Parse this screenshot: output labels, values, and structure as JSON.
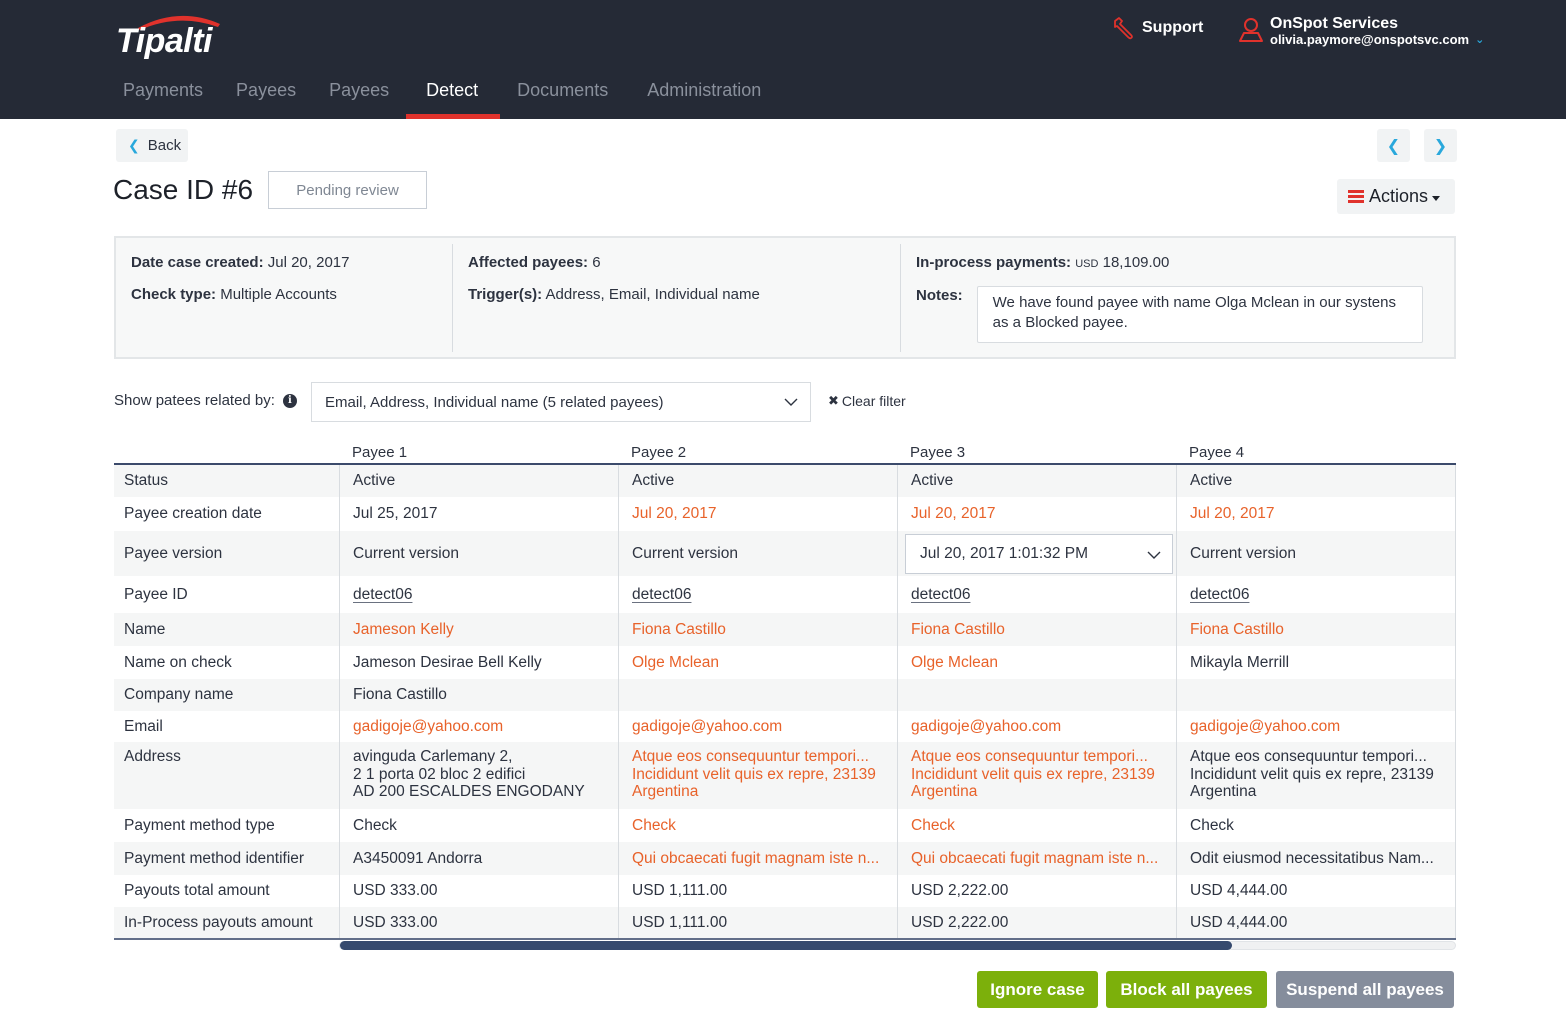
{
  "header": {
    "logo_text": "Tipalti",
    "nav": [
      {
        "label": "Payments",
        "active": false
      },
      {
        "label": "Payees",
        "active": false
      },
      {
        "label": "Payees",
        "active": false
      },
      {
        "label": "Detect",
        "active": true
      },
      {
        "label": "Documents",
        "active": false
      },
      {
        "label": "Administration",
        "active": false
      }
    ],
    "support_label": "Support",
    "account": {
      "company": "OnSpot Services",
      "email": "olivia.paymore@onspotsvc.com"
    }
  },
  "page": {
    "back_label": "Back",
    "title": "Case ID #6",
    "status": "Pending review",
    "actions_label": "Actions"
  },
  "info": {
    "date_created_label": "Date case created:",
    "date_created": "Jul 20, 2017",
    "check_type_label": "Check type:",
    "check_type": "Multiple Accounts",
    "affected_label": "Affected payees:",
    "affected": "6",
    "triggers_label": "Trigger(s):",
    "triggers": "Address, Email, Individual name",
    "inprocess_label": "In-process payments:",
    "inprocess_currency": "USD",
    "inprocess_amount": "18,109.00",
    "notes_label": "Notes:",
    "notes": "We have found payee with name Olga Mclean in our systens as a Blocked payee."
  },
  "filter": {
    "label": "Show patees related by:",
    "selected": "Email, Address, Individual name (5 related payees)",
    "clear_label": "Clear filter"
  },
  "table": {
    "columns": [
      "Payee 1",
      "Payee 2",
      "Payee 3",
      "Payee 4"
    ],
    "scroll_fraction": 0.8,
    "rows": [
      {
        "label": "Status",
        "cells": [
          {
            "text": "Active"
          },
          {
            "text": "Active"
          },
          {
            "text": "Active"
          },
          {
            "text": "Active"
          }
        ]
      },
      {
        "label": "Payee creation date",
        "cells": [
          {
            "text": "Jul 25, 2017"
          },
          {
            "text": "Jul 20, 2017",
            "hl": true
          },
          {
            "text": "Jul 20, 2017",
            "hl": true
          },
          {
            "text": "Jul 20, 2017",
            "hl": true
          }
        ]
      },
      {
        "label": "Payee version",
        "cells": [
          {
            "text": "Current version"
          },
          {
            "text": "Current version"
          },
          {
            "text": "Jul 20, 2017 1:01:32 PM",
            "select": true
          },
          {
            "text": "Current version"
          }
        ]
      },
      {
        "label": "Payee ID",
        "cells": [
          {
            "text": "detect06",
            "link": true
          },
          {
            "text": "detect06",
            "link": true
          },
          {
            "text": "detect06",
            "link": true
          },
          {
            "text": "detect06",
            "link": true
          }
        ]
      },
      {
        "label": "Name",
        "cells": [
          {
            "text": "Jameson Kelly",
            "hl": true
          },
          {
            "text": "Fiona Castillo",
            "hl": true
          },
          {
            "text": "Fiona Castillo",
            "hl": true
          },
          {
            "text": "Fiona Castillo",
            "hl": true
          }
        ]
      },
      {
        "label": "Name on check",
        "cells": [
          {
            "text": "Jameson Desirae Bell Kelly"
          },
          {
            "text": "Olge Mclean",
            "hl": true
          },
          {
            "text": "Olge Mclean",
            "hl": true
          },
          {
            "text": "Mikayla Merrill"
          }
        ]
      },
      {
        "label": "Company name",
        "cells": [
          {
            "text": "Fiona Castillo"
          },
          {
            "text": ""
          },
          {
            "text": ""
          },
          {
            "text": ""
          }
        ]
      },
      {
        "label": "Email",
        "cells": [
          {
            "text": "gadigoje@yahoo.com",
            "hl": true
          },
          {
            "text": "gadigoje@yahoo.com",
            "hl": true
          },
          {
            "text": "gadigoje@yahoo.com",
            "hl": true
          },
          {
            "text": "gadigoje@yahoo.com",
            "hl": true
          }
        ]
      },
      {
        "label": "Address",
        "cells": [
          {
            "lines": [
              "avinguda Carlemany 2,",
              "2 1 porta 02 bloc 2 edifici",
              "AD 200 ESCALDES ENGODANY"
            ]
          },
          {
            "lines": [
              "Atque eos consequuntur tempori...",
              "Incididunt  velit quis ex repre, 23139",
              "Argentina"
            ],
            "hl": true
          },
          {
            "lines": [
              "Atque eos consequuntur tempori...",
              "Incididunt  velit quis ex repre, 23139",
              "Argentina"
            ],
            "hl": true
          },
          {
            "lines": [
              "Atque eos consequuntur tempori...",
              "Incididunt  velit quis ex repre, 23139",
              "Argentina"
            ]
          }
        ]
      },
      {
        "label": "Payment method type",
        "cells": [
          {
            "text": "Check"
          },
          {
            "text": "Check",
            "hl": true
          },
          {
            "text": "Check",
            "hl": true
          },
          {
            "text": "Check"
          }
        ]
      },
      {
        "label": "Payment method identifier",
        "cells": [
          {
            "text": "A3450091 Andorra"
          },
          {
            "text": "Qui obcaecati fugit magnam iste n...",
            "hl": true
          },
          {
            "text": "Qui obcaecati fugit magnam iste n...",
            "hl": true
          },
          {
            "text": "Odit eiusmod necessitatibus Nam..."
          }
        ]
      },
      {
        "label": "Payouts total amount",
        "cells": [
          {
            "text": "USD 333.00"
          },
          {
            "text": "USD 1,111.00"
          },
          {
            "text": "USD 2,222.00"
          },
          {
            "text": "USD 4,444.00"
          }
        ]
      },
      {
        "label": "In-Process payouts amount",
        "cells": [
          {
            "text": "USD 333.00"
          },
          {
            "text": "USD 1,111.00"
          },
          {
            "text": "USD 2,222.00"
          },
          {
            "text": "USD 4,444.00"
          }
        ]
      }
    ]
  },
  "footer": {
    "ignore_label": "Ignore case",
    "block_label": "Block all payees",
    "suspend_label": "Suspend all payees"
  },
  "colors": {
    "header_bg": "#252a36",
    "accent_red": "#e0322c",
    "highlight_orange": "#e8622a",
    "link_blue": "#29a8dc",
    "button_green": "#7cb00b",
    "button_grey": "#858d9c"
  }
}
